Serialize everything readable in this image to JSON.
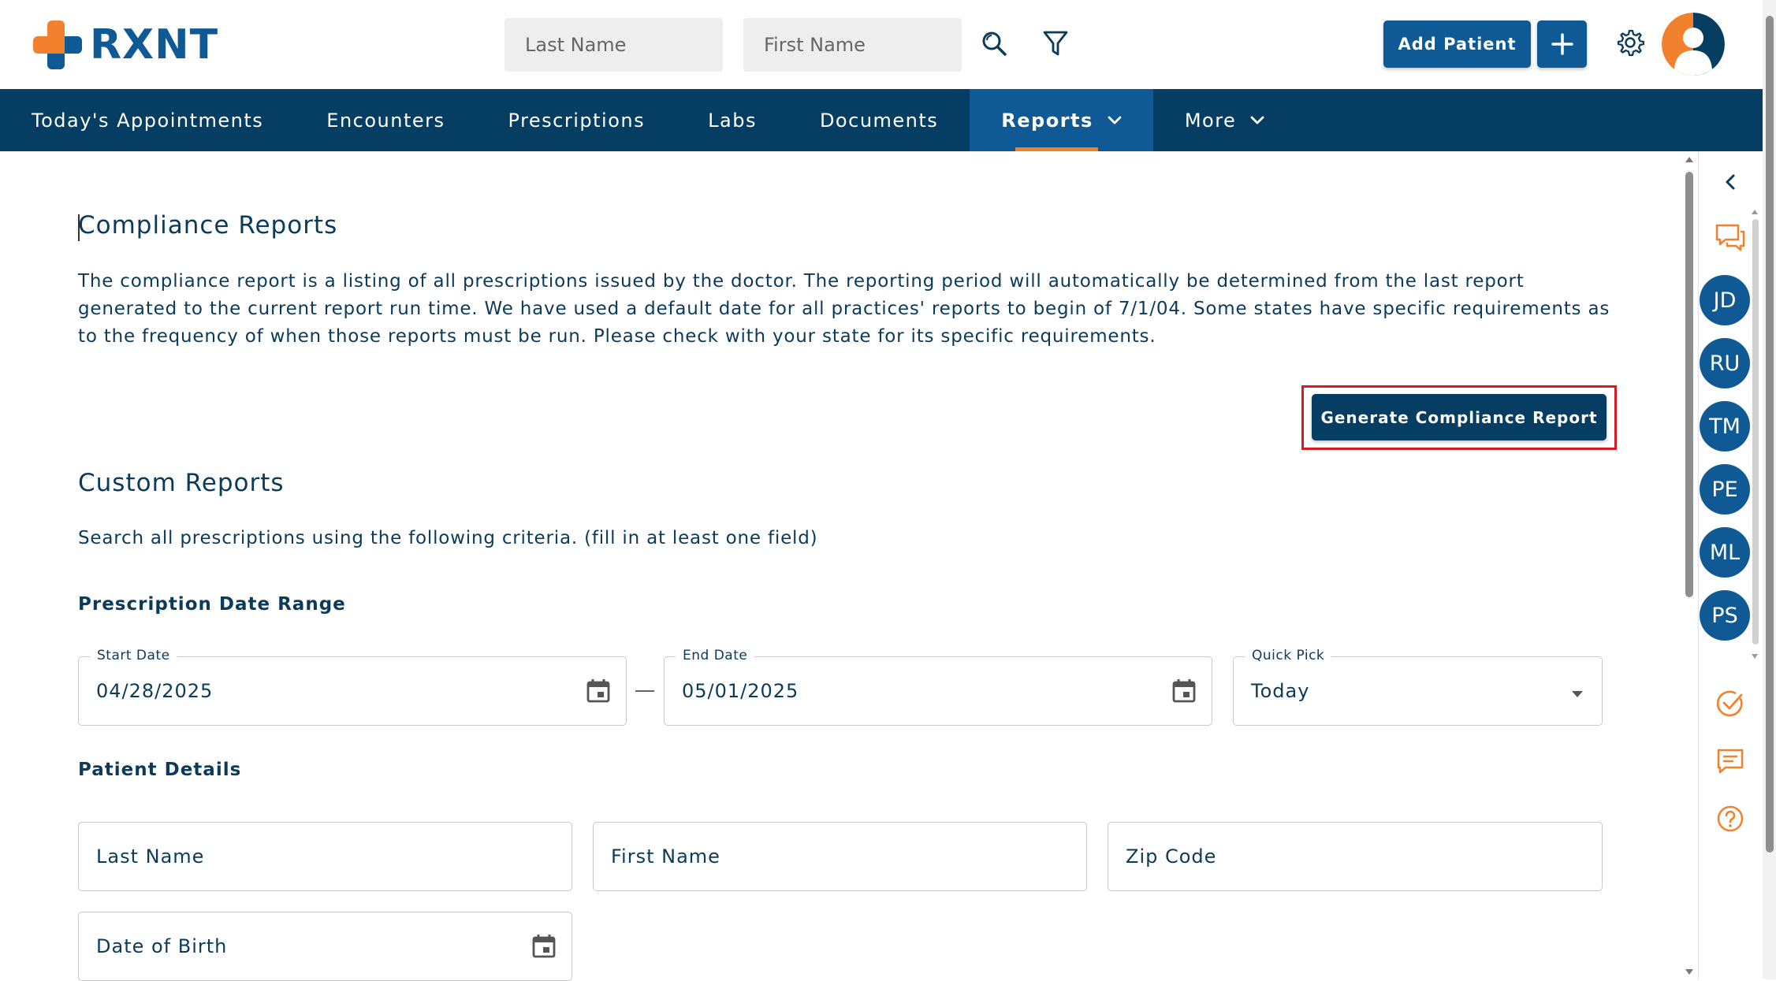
{
  "brand": {
    "name": "RXNT"
  },
  "header": {
    "search_last_placeholder": "Last Name",
    "search_first_placeholder": "First Name",
    "add_patient_label": "Add Patient",
    "icons": {
      "search": "search-icon",
      "filter": "filter-icon",
      "plus": "plus-icon",
      "settings": "gear-icon",
      "avatar": "user-avatar-icon"
    }
  },
  "nav": {
    "items": [
      {
        "label": "Today's Appointments"
      },
      {
        "label": "Encounters"
      },
      {
        "label": "Prescriptions"
      },
      {
        "label": "Labs"
      },
      {
        "label": "Documents"
      },
      {
        "label": "Reports",
        "active": true
      },
      {
        "label": "More"
      }
    ]
  },
  "compliance": {
    "title": "Compliance Reports",
    "description": "The compliance report is a listing of all prescriptions issued by the doctor. The reporting period will automatically be determined from the last report generated to the current report run time. We have used a default date for all practices' reports to begin of 7/1/04. Some states have specific requirements as to the frequency of when those reports must be run. Please check with your state for its specific requirements.",
    "button_label": "Generate Compliance Report"
  },
  "custom": {
    "title": "Custom Reports",
    "subtitle": "Search all prescriptions using the following criteria. (fill in at least one field)",
    "date_range_label": "Prescription Date Range",
    "start_date_label": "Start Date",
    "start_date_value": "04/28/2025",
    "end_date_label": "End Date",
    "end_date_value": "05/01/2025",
    "quick_pick_label": "Quick Pick",
    "quick_pick_value": "Today",
    "patient_details_label": "Patient Details",
    "last_name_placeholder": "Last Name",
    "first_name_placeholder": "First Name",
    "zip_placeholder": "Zip Code",
    "dob_placeholder": "Date of Birth"
  },
  "sidebar": {
    "users": [
      "JD",
      "RU",
      "TM",
      "PE",
      "ML",
      "PS"
    ]
  },
  "colors": {
    "primary": "#0f5a94",
    "nav": "#063d62",
    "accent": "#f2812e",
    "highlight": "#d81b23"
  }
}
